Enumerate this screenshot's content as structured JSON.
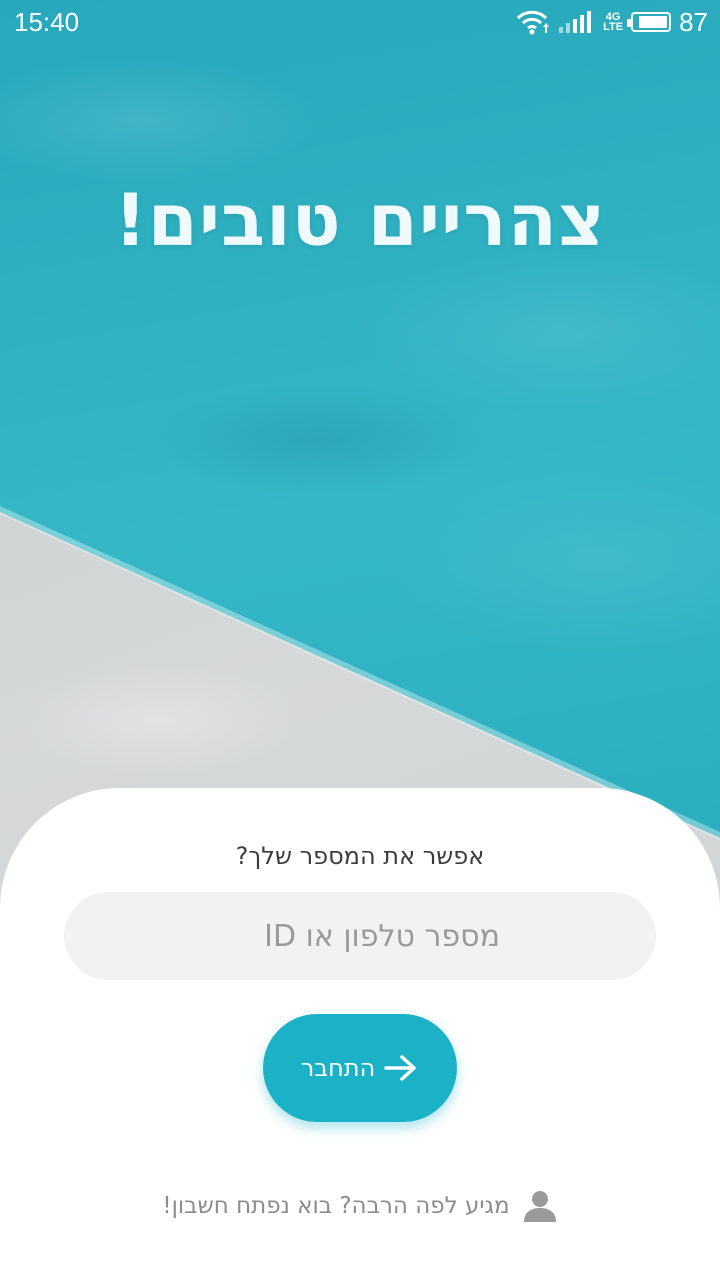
{
  "status_bar": {
    "time": "15:40",
    "network_top": "4G",
    "network_bottom": "LTE",
    "battery_level": "87",
    "icons": [
      "wifi-icon",
      "signal-icon",
      "battery-icon"
    ]
  },
  "greeting": "צהריים טובים!",
  "login": {
    "prompt": "אפשר את המספר שלך?",
    "input_placeholder": "מספר טלפון או ID",
    "input_value": "",
    "connect_label": "התחבר",
    "connect_icon": "arrow-right-icon",
    "signup_text": "מגיע לפה הרבה? בוא נפתח חשבון!",
    "signup_icon": "user-icon"
  },
  "colors": {
    "accent": "#1bb2c8",
    "water": "#2fb3c4",
    "card": "#ffffff",
    "input_bg": "#f2f2f2"
  }
}
